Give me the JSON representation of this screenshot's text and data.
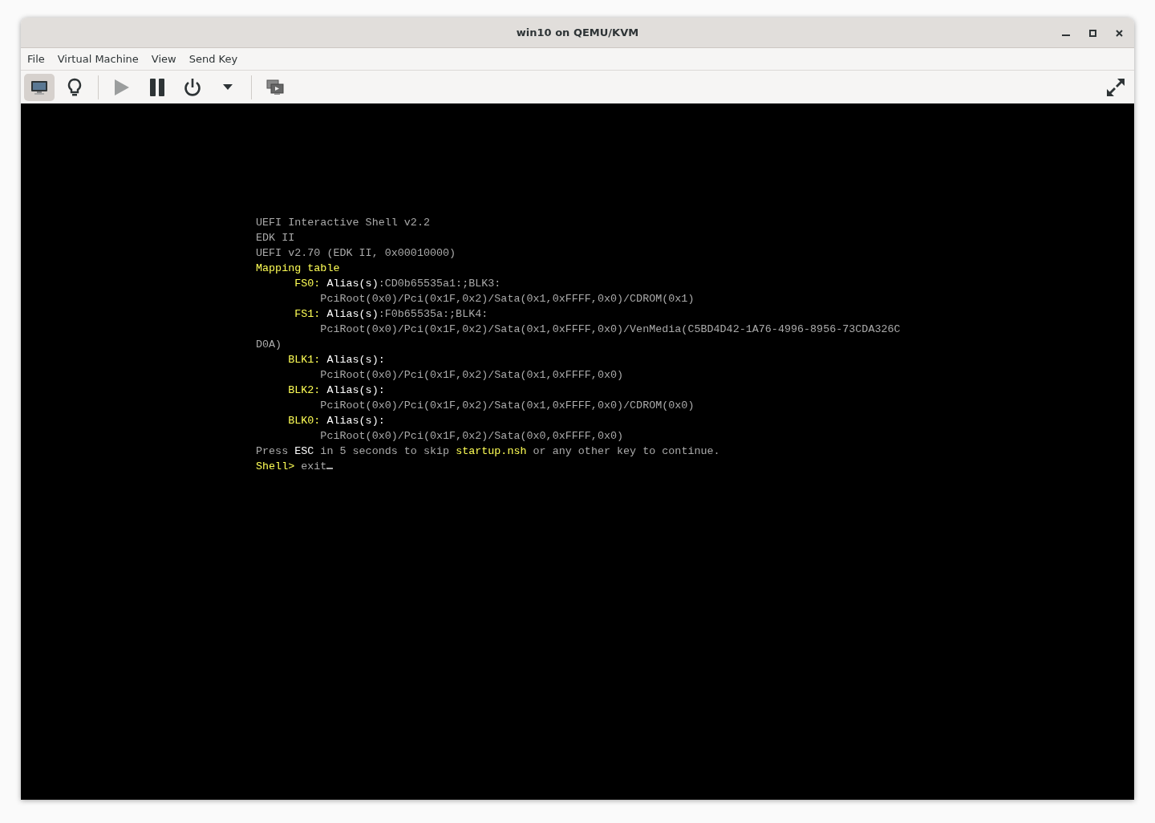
{
  "window": {
    "title": "win10 on QEMU/KVM"
  },
  "menu": [
    "File",
    "Virtual Machine",
    "View",
    "Send Key"
  ],
  "toolbar": [
    {
      "kind": "console",
      "selected": true,
      "disabled": false
    },
    {
      "kind": "details",
      "selected": false,
      "disabled": false
    },
    {
      "kind": "separator"
    },
    {
      "kind": "run",
      "selected": false,
      "disabled": true
    },
    {
      "kind": "pause",
      "selected": false,
      "disabled": false
    },
    {
      "kind": "power",
      "selected": false,
      "disabled": false
    },
    {
      "kind": "dropdown",
      "selected": false,
      "disabled": false
    },
    {
      "kind": "separator"
    },
    {
      "kind": "snapshots",
      "selected": false,
      "disabled": false
    },
    {
      "kind": "fullscreen",
      "selected": false,
      "disabled": false
    }
  ],
  "console": {
    "lines": [
      {
        "kind": "plain",
        "segments": [
          {
            "color": "#aaaaaa",
            "text": "UEFI Interactive Shell v2.2"
          }
        ]
      },
      {
        "kind": "plain",
        "segments": [
          {
            "color": "#aaaaaa",
            "text": "EDK II"
          }
        ]
      },
      {
        "kind": "plain",
        "segments": [
          {
            "color": "#aaaaaa",
            "text": "UEFI v2.70 (EDK II, 0x00010000)"
          }
        ]
      },
      {
        "kind": "plain",
        "segments": [
          {
            "color": "#ffff55",
            "text": "Mapping table"
          }
        ]
      },
      {
        "kind": "fs",
        "segments": [
          {
            "color": "#ffff55",
            "text": "FS0: "
          },
          {
            "color": "#ffffff",
            "text": "Alias(s)"
          },
          {
            "color": "#aaaaaa",
            "text": ":CD0b65535a1:;BLK3:"
          }
        ]
      },
      {
        "kind": "path",
        "segments": [
          {
            "color": "#aaaaaa",
            "text": "PciRoot(0x0)/Pci(0x1F,0x2)/Sata(0x1,0xFFFF,0x0)/CDROM(0x1)"
          }
        ]
      },
      {
        "kind": "fs",
        "segments": [
          {
            "color": "#ffff55",
            "text": "FS1: "
          },
          {
            "color": "#ffffff",
            "text": "Alias(s)"
          },
          {
            "color": "#aaaaaa",
            "text": ":F0b65535a:;BLK4:"
          }
        ]
      },
      {
        "kind": "path",
        "segments": [
          {
            "color": "#aaaaaa",
            "text": "PciRoot(0x0)/Pci(0x1F,0x2)/Sata(0x1,0xFFFF,0x0)/VenMedia(C5BD4D42-1A76-4996-8956-73CDA326C"
          }
        ]
      },
      {
        "kind": "plain",
        "segments": [
          {
            "color": "#aaaaaa",
            "text": "D0A)"
          }
        ]
      },
      {
        "kind": "blk",
        "segments": [
          {
            "color": "#ffff55",
            "text": "BLK1: "
          },
          {
            "color": "#ffffff",
            "text": "Alias(s):"
          }
        ]
      },
      {
        "kind": "path",
        "segments": [
          {
            "color": "#aaaaaa",
            "text": "PciRoot(0x0)/Pci(0x1F,0x2)/Sata(0x1,0xFFFF,0x0)"
          }
        ]
      },
      {
        "kind": "blk",
        "segments": [
          {
            "color": "#ffff55",
            "text": "BLK2: "
          },
          {
            "color": "#ffffff",
            "text": "Alias(s):"
          }
        ]
      },
      {
        "kind": "path",
        "segments": [
          {
            "color": "#aaaaaa",
            "text": "PciRoot(0x0)/Pci(0x1F,0x2)/Sata(0x1,0xFFFF,0x0)/CDROM(0x0)"
          }
        ]
      },
      {
        "kind": "blk",
        "segments": [
          {
            "color": "#ffff55",
            "text": "BLK0: "
          },
          {
            "color": "#ffffff",
            "text": "Alias(s):"
          }
        ]
      },
      {
        "kind": "path",
        "segments": [
          {
            "color": "#aaaaaa",
            "text": "PciRoot(0x0)/Pci(0x1F,0x2)/Sata(0x0,0xFFFF,0x0)"
          }
        ]
      },
      {
        "kind": "plain",
        "segments": [
          {
            "color": "#aaaaaa",
            "text": "Press "
          },
          {
            "color": "#ffffff",
            "text": "ESC"
          },
          {
            "color": "#aaaaaa",
            "text": " in 5 seconds to skip "
          },
          {
            "color": "#ffff55",
            "text": "startup.nsh"
          },
          {
            "color": "#aaaaaa",
            "text": " or any other key to continue."
          }
        ]
      },
      {
        "kind": "prompt",
        "segments": [
          {
            "color": "#ffff55",
            "text": "Shell> "
          },
          {
            "color": "#aaaaaa",
            "text": "exit"
          }
        ]
      }
    ]
  }
}
